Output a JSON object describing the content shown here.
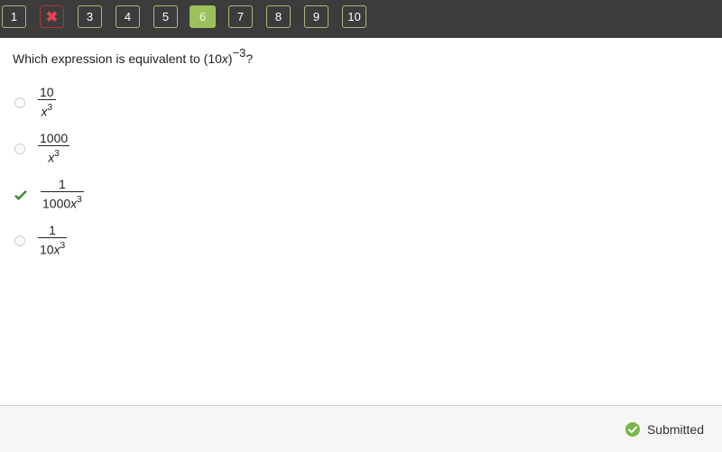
{
  "nav": {
    "items": [
      {
        "label": "1",
        "state": "normal"
      },
      {
        "label": "✖",
        "state": "wrong"
      },
      {
        "label": "3",
        "state": "normal"
      },
      {
        "label": "4",
        "state": "normal"
      },
      {
        "label": "5",
        "state": "normal"
      },
      {
        "label": "6",
        "state": "active"
      },
      {
        "label": "7",
        "state": "normal"
      },
      {
        "label": "8",
        "state": "normal"
      },
      {
        "label": "9",
        "state": "normal"
      },
      {
        "label": "10",
        "state": "normal"
      }
    ]
  },
  "question": {
    "prefix": "Which expression is equivalent to (10",
    "var": "x",
    "close": ")",
    "exponent": "−3",
    "suffix": "?"
  },
  "options": [
    {
      "numerator": "10",
      "den_text": "",
      "den_var": "x",
      "den_exp": "3",
      "selected": false,
      "icon": "radio-icon"
    },
    {
      "numerator": "1000",
      "den_text": "",
      "den_var": "x",
      "den_exp": "3",
      "selected": false,
      "icon": "radio-icon"
    },
    {
      "numerator": "1",
      "den_text": "1000",
      "den_var": "x",
      "den_exp": "3",
      "selected": true,
      "icon": "checkmark-icon"
    },
    {
      "numerator": "1",
      "den_text": "10",
      "den_var": "x",
      "den_exp": "3",
      "selected": false,
      "icon": "radio-icon"
    }
  ],
  "footer": {
    "status": "Submitted",
    "status_icon": "check-circle-icon"
  },
  "colors": {
    "topbar": "#3c3c3c",
    "nav_border": "#a8b97a",
    "active": "#9cc15a",
    "wrong": "#e04550",
    "correct_check": "#3a8a2a",
    "status_green": "#7ab648"
  }
}
